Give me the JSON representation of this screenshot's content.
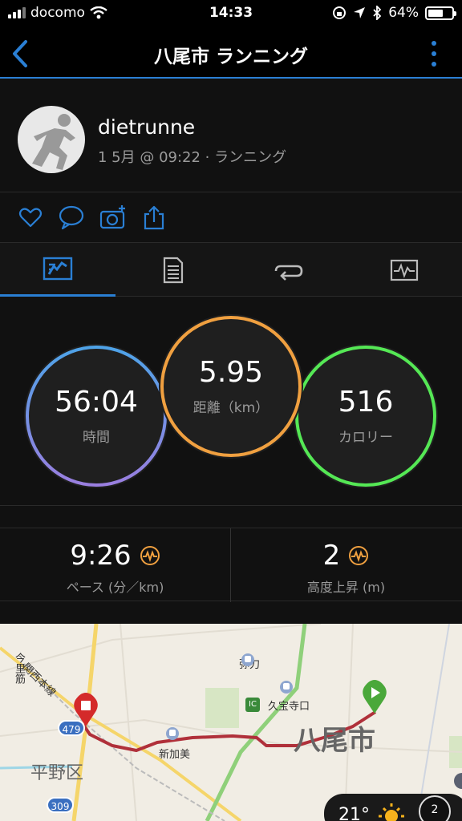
{
  "status_bar": {
    "carrier": "docomo",
    "time": "14:33",
    "battery": "64%",
    "battery_level": 0.64
  },
  "nav": {
    "title": "八尾市 ランニング"
  },
  "profile": {
    "username": "dietrunne",
    "meta": "1 5月 @ 09:22 · ランニング"
  },
  "actions": [
    "heart-icon",
    "comment-icon",
    "camera-add-icon",
    "share-icon"
  ],
  "tabs": [
    "stats-icon",
    "details-icon",
    "laps-icon",
    "chart-icon"
  ],
  "stats": {
    "time": {
      "value": "56:04",
      "label": "時間",
      "color": "#8a84e0"
    },
    "distance": {
      "value": "5.95",
      "label": "距離（km）",
      "color": "#f0a040"
    },
    "calories": {
      "value": "516",
      "label": "カロリー",
      "color": "#55e855"
    }
  },
  "metrics": {
    "pace": {
      "value": "9:26",
      "label": "ペース (分／km)"
    },
    "elevation": {
      "value": "2",
      "label": "高度上昇 (m)"
    }
  },
  "map": {
    "labels": {
      "imazato": "今里筋",
      "kansai_line": "関西本線",
      "yuge": "弥刀",
      "kyuhoji": "久宝寺口",
      "shinkami": "新加美",
      "yao_city": "八尾市",
      "hirano": "平野区",
      "ic": "IC",
      "route479": "479",
      "route309": "309"
    },
    "weather_temp": "21°",
    "compass": "2"
  },
  "colors": {
    "accent": "#2a7fd4",
    "route": "#b0303a",
    "start_marker": "#4aa83a",
    "end_marker": "#d42a2a"
  }
}
